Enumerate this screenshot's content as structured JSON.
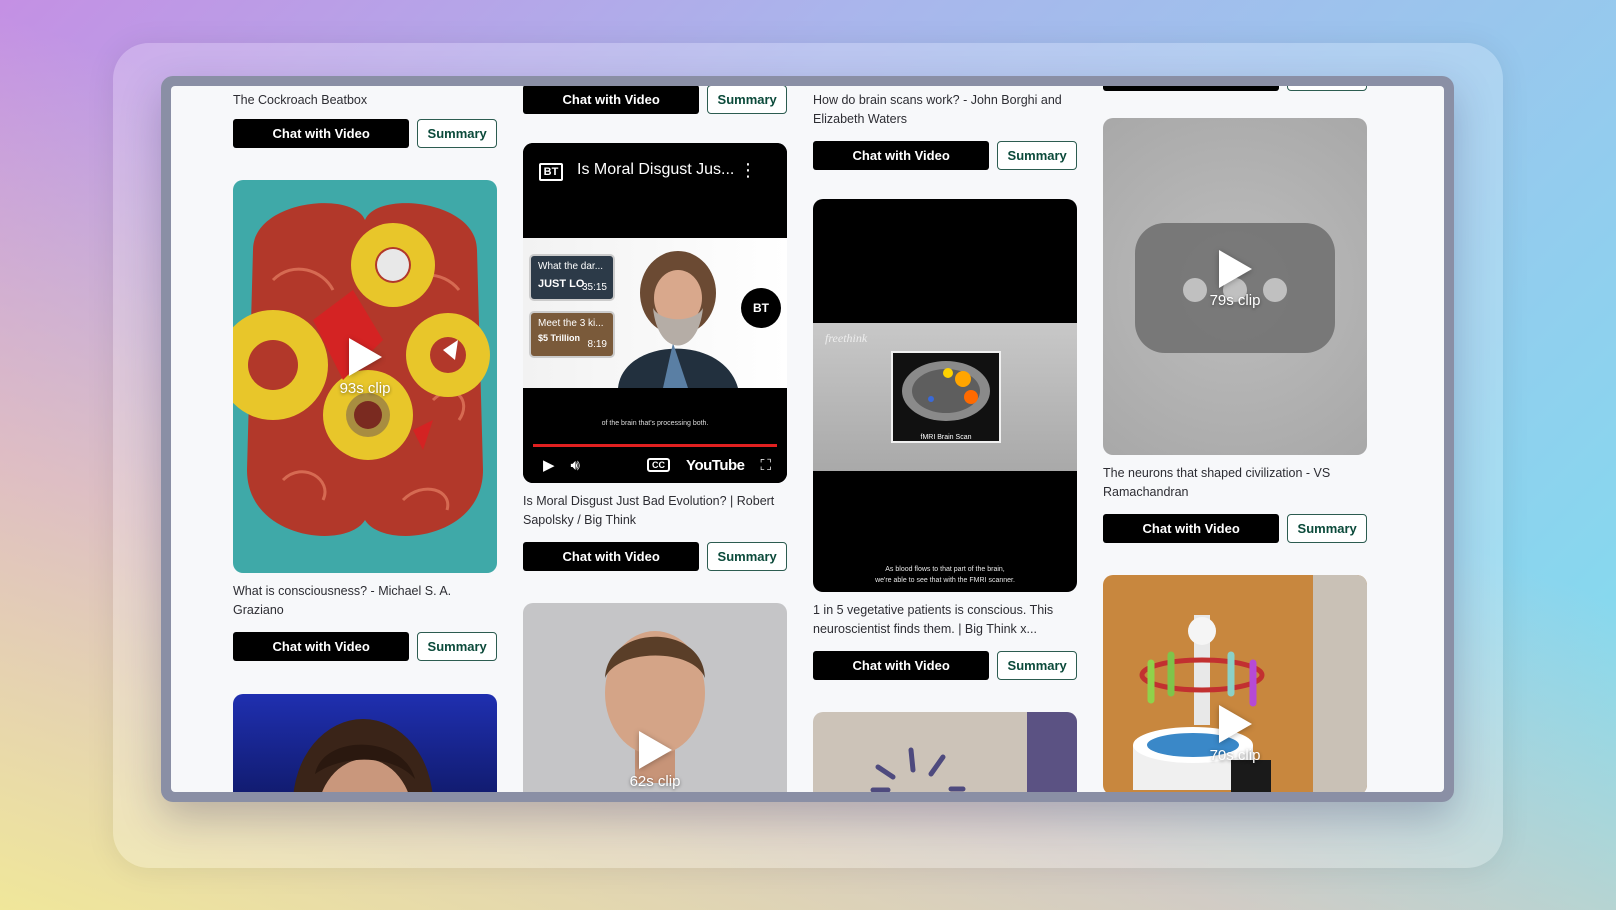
{
  "buttons": {
    "chat": "Chat with Video",
    "summary": "Summary"
  },
  "columns": [
    {
      "cards": [
        {
          "title": "The Cockroach Beatbox"
        },
        {
          "title": "What is consciousness? - Michael S. A. Graziano",
          "clip": "93s clip"
        },
        {
          "title": ""
        }
      ]
    },
    {
      "cards": [
        {
          "title": ""
        },
        {
          "title": "Is Moral Disgust Just Bad Evolution? | Robert Sapolsky / Big Think",
          "embed": {
            "channel_logo": "BT",
            "header_title": "Is Moral Disgust Jus...",
            "suggestions": [
              {
                "title": "What the dar...",
                "subtitle": "JUST LO",
                "duration": "35:15"
              },
              {
                "title": "Meet the 3 ki...",
                "subtitle": "$5 Trillion",
                "duration": "8:19"
              }
            ],
            "caption": "of the brain that's processing both.",
            "brand": "YouTube",
            "cc": "CC"
          }
        },
        {
          "title": "",
          "clip": "62s clip"
        }
      ]
    },
    {
      "cards": [
        {
          "title": "How do brain scans work? - John Borghi and Elizabeth Waters"
        },
        {
          "title": "1 in 5 vegetative patients is conscious. This neuroscientist finds them. | Big Think x...",
          "video": {
            "watermark": "freethink",
            "scan_label": "fMRI Brain Scan",
            "caption_line1": "As blood flows to that part of the brain,",
            "caption_line2": "we're able to see that with the FMRI scanner."
          }
        },
        {
          "title": ""
        }
      ]
    },
    {
      "cards": [
        {
          "title": ""
        },
        {
          "title": "The neurons that shaped civilization - VS Ramachandran",
          "clip": "79s clip"
        },
        {
          "title": "",
          "clip": "70s clip"
        }
      ]
    }
  ]
}
